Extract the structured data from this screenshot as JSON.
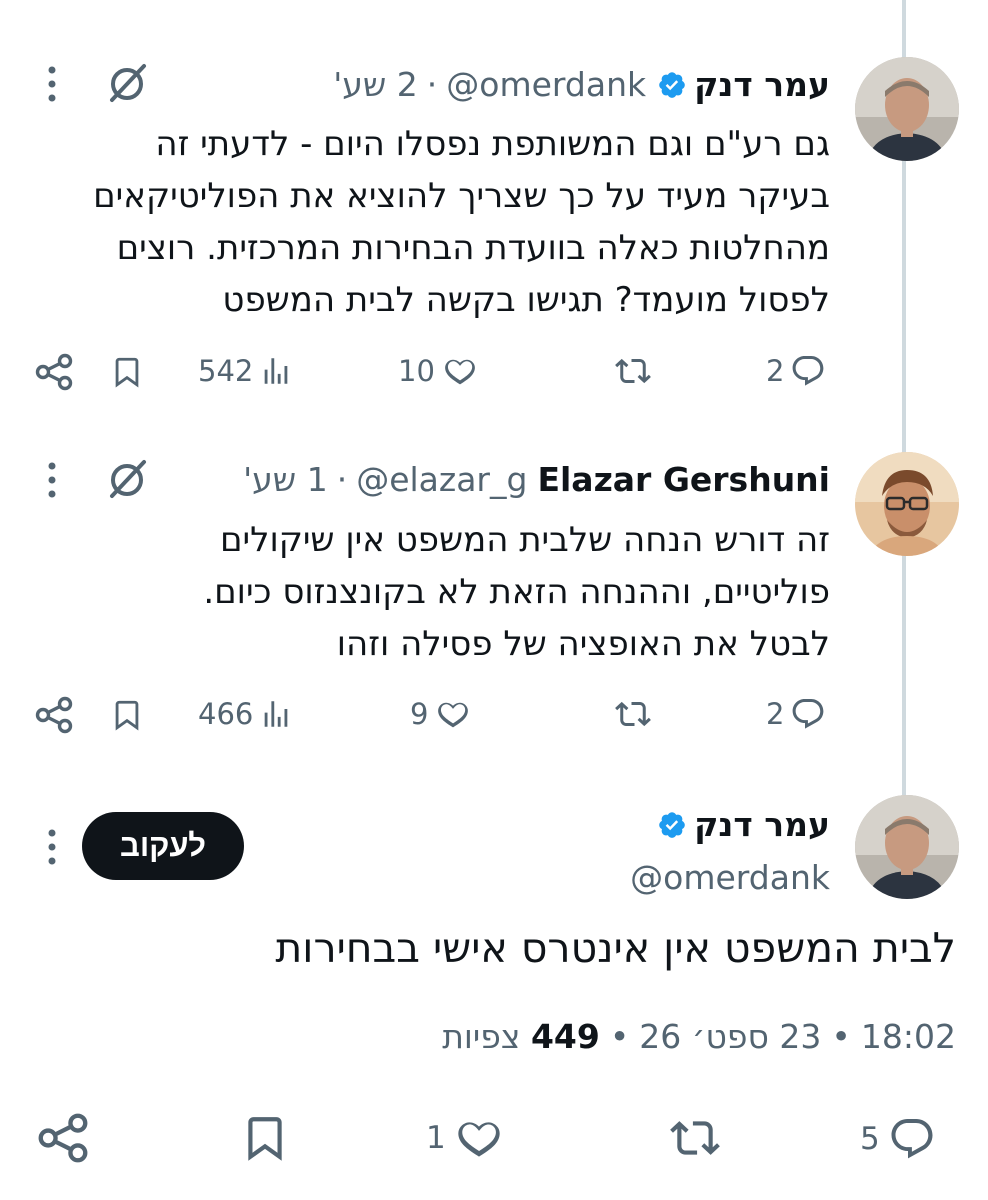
{
  "thread": [
    {
      "author_name": "עמר דנק",
      "handle": "@omerdank",
      "time": "2 שע'",
      "verified": true,
      "text_lines": [
        "גם רע\"ם וגם המשותפת נפסלו היום - לדעתי זה",
        "בעיקר מעיד על כך שצריך להוציא את הפוליטיקאים",
        "מהחלטות כאלה בוועדת הבחירות המרכזית. רוצים",
        "לפסול מועמד? תגישו בקשה לבית המשפט"
      ],
      "replies": "2",
      "likes": "10",
      "views": "542"
    },
    {
      "author_name": "Elazar Gershuni",
      "handle": "@elazar_g",
      "time": "1 שע'",
      "verified": false,
      "text_lines": [
        "זה דורש הנחה שלבית המשפט אין שיקולים",
        "פוליטיים, וההנחה הזאת לא בקונצנזוס כיום.",
        "לבטל את האופציה של פסילה וזהו"
      ],
      "replies": "2",
      "likes": "9",
      "views": "466"
    }
  ],
  "focused": {
    "author_name": "עמר דנק",
    "handle": "@omerdank",
    "verified": true,
    "follow_label": "לעקוב",
    "text": "לבית המשפט אין אינטרס אישי בבחירות",
    "time": "18:02",
    "date": "23 ספט׳ 26",
    "views_count": "449",
    "views_label": "צפיות",
    "replies": "5",
    "likes": "1"
  },
  "colors": {
    "text": "#0f1419",
    "secondary": "#536471",
    "verified_blue": "#1d9bf0",
    "thread_line": "#cfd9de"
  },
  "icons": [
    "verified-badge-icon",
    "grok-icon",
    "more-options-icon",
    "reply-icon",
    "retweet-icon",
    "like-icon",
    "views-icon",
    "bookmark-icon",
    "share-icon"
  ]
}
